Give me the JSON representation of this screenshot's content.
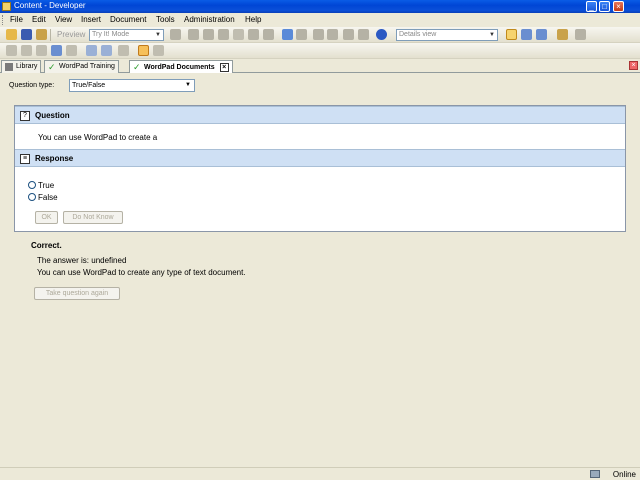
{
  "window": {
    "title": "Content - Developer"
  },
  "menu": [
    "File",
    "Edit",
    "View",
    "Insert",
    "Document",
    "Tools",
    "Administration",
    "Help"
  ],
  "toolbar": {
    "preview_label": "Preview",
    "mode_combo": "Try It! Mode",
    "view_combo": "Details view"
  },
  "tabs": [
    {
      "label": "Library",
      "icon": "library-icon"
    },
    {
      "label": "WordPad Training",
      "icon": "check-icon"
    },
    {
      "label": "WordPad Documents",
      "icon": "check-icon",
      "active": true
    }
  ],
  "question_type": {
    "label": "Question type:",
    "value": "True/False"
  },
  "question": {
    "header": "Question",
    "text": "You can use WordPad to create a"
  },
  "response": {
    "header": "Response",
    "options": [
      "True",
      "False"
    ],
    "ok_label": "OK",
    "dont_know_label": "Do Not Know"
  },
  "feedback": {
    "title": "Correct.",
    "answer_line": "The answer is: undefined",
    "explanation": "You can use WordPad to create any type of text document.",
    "retry_label": "Take question again"
  },
  "status": {
    "text": "Online"
  },
  "colors": {
    "section_header": "#cfe0f4",
    "titlebar": "#0a5ce6"
  }
}
